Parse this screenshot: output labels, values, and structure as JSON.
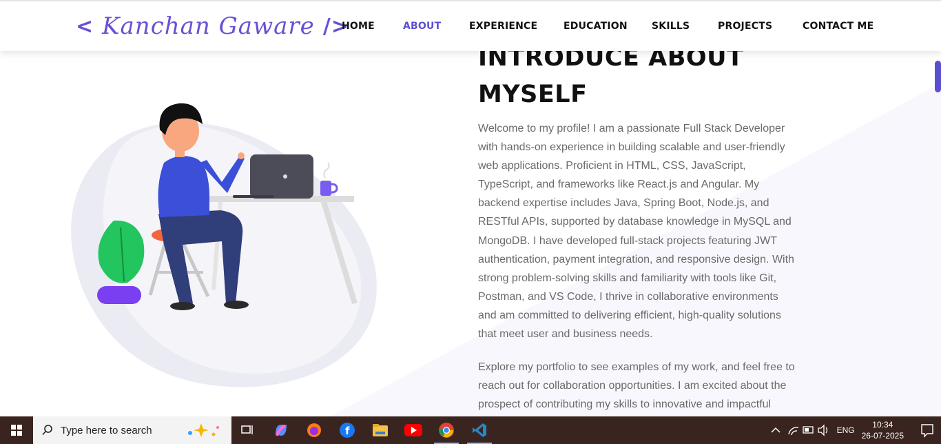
{
  "logo": {
    "open": "<",
    "name": "Kanchan Gaware",
    "close": "/>"
  },
  "nav": {
    "items": [
      {
        "label": "HOME"
      },
      {
        "label": "ABOUT"
      },
      {
        "label": "EXPERIENCE"
      },
      {
        "label": "EDUCATION"
      },
      {
        "label": "SKILLS"
      },
      {
        "label": "PROJECTS"
      },
      {
        "label": "CONTACT ME"
      }
    ],
    "active": "ABOUT"
  },
  "about": {
    "heading_line1": "INTRODUCE ABOUT",
    "heading_line2": "MYSELF",
    "paragraph1": "Welcome to my profile! I am a passionate Full Stack Developer with hands-on experience in building scalable and user-friendly web applications. Proficient in HTML, CSS, JavaScript, TypeScript, and frameworks like React.js and Angular. My backend expertise includes Java, Spring Boot, Node.js, and RESTful APIs, supported by database knowledge in MySQL and MongoDB. I have developed full-stack projects featuring JWT authentication, payment integration, and responsive design. With strong problem-solving skills and familiarity with tools like Git, Postman, and VS Code, I thrive in collaborative environments and am committed to delivering efficient, high-quality solutions that meet user and business needs.",
    "paragraph2": "Explore my portfolio to see examples of my work, and feel free to reach out for collaboration opportunities. I am excited about the prospect of contributing my skills to innovative and impactful"
  },
  "colors": {
    "accent": "#5b4fd1",
    "logo": "#6a4fd6",
    "taskbar": "#3a2420"
  },
  "taskbar": {
    "search_placeholder": "Type here to search",
    "apps": [
      "task-view-icon",
      "copilot-icon",
      "firefox-icon",
      "facebook-icon",
      "file-explorer-icon",
      "youtube-icon",
      "chrome-icon",
      "vscode-icon"
    ],
    "language": "ENG",
    "time": "10:34",
    "date": "26-07-2025"
  }
}
